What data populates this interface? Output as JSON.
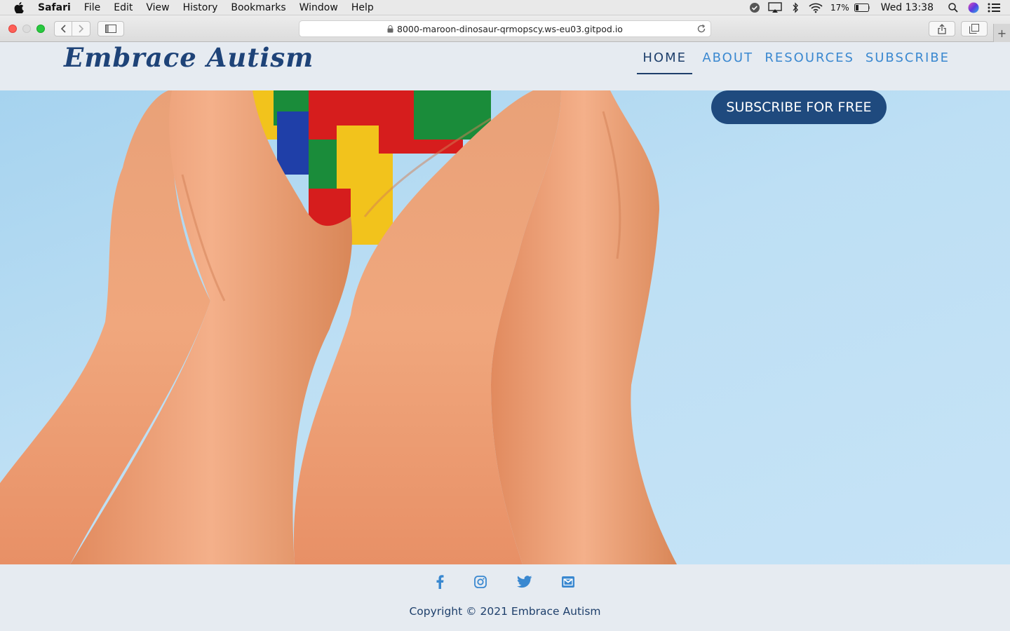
{
  "menubar": {
    "app_name": "Safari",
    "items": [
      "File",
      "Edit",
      "View",
      "History",
      "Bookmarks",
      "Window",
      "Help"
    ],
    "battery": "17%",
    "clock": "Wed 13:38"
  },
  "browser": {
    "url": "8000-maroon-dinosaur-qrmopscy.ws-eu03.gitpod.io"
  },
  "site": {
    "logo": "Embrace Autism",
    "nav": [
      {
        "label": "HOME",
        "active": true
      },
      {
        "label": "ABOUT",
        "active": false
      },
      {
        "label": "RESOURCES",
        "active": false
      },
      {
        "label": "SUBSCRIBE",
        "active": false
      }
    ],
    "hero_cta": "SUBSCRIBE FOR FREE",
    "social_icons": [
      "facebook-icon",
      "instagram-icon",
      "twitter-icon",
      "envelope-icon"
    ],
    "copyright": "Copyright © 2021 Embrace Autism"
  },
  "colors": {
    "brand_dark": "#1e4378",
    "nav_link": "#3a88d0",
    "cta_bg": "#1f4a7e",
    "page_bg": "#e6ebf1"
  }
}
